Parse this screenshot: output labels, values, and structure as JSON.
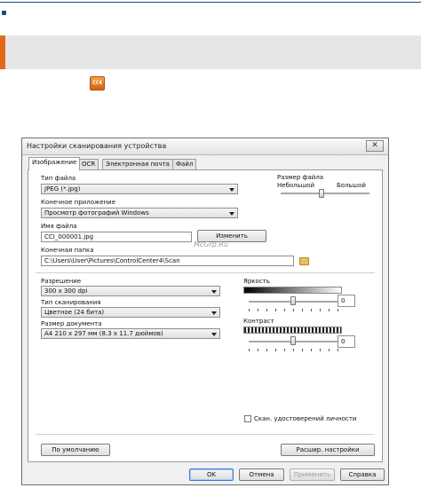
{
  "page": {
    "watermark": "McGrp.Ru"
  },
  "header_icon": {
    "label": "CC4"
  },
  "dialog": {
    "title": "Настройки сканирования устройства",
    "close_glyph": "✕",
    "tabs": [
      {
        "label": "Изображение",
        "active": true
      },
      {
        "label": "OCR",
        "active": false
      },
      {
        "label": "Электронная почта",
        "active": false
      },
      {
        "label": "Файл",
        "active": false
      }
    ],
    "file_type": {
      "label": "Тип файла",
      "value": "JPEG (*.jpg)"
    },
    "file_size": {
      "label": "Размер файла",
      "min_label": "Небольшой",
      "max_label": "Большой"
    },
    "target_app": {
      "label": "Конечное приложение",
      "value": "Просмотр фотографий Windows"
    },
    "file_name": {
      "label": "Имя файла",
      "value": "CCI_000001.jpg",
      "change_button": "Изменить"
    },
    "destination_folder": {
      "label": "Конечная папка",
      "value": "C:\\Users\\User\\Pictures\\ControlCenter4\\Scan"
    },
    "resolution": {
      "label": "Разрешение",
      "value": "300 x 300  dpi"
    },
    "scan_type": {
      "label": "Тип сканирования",
      "value": "Цветное (24 бита)"
    },
    "document_size": {
      "label": "Размер документа",
      "value": "A4 210 x 297 мм (8.3 x 11.7 дюймов)"
    },
    "brightness": {
      "label": "Яркость",
      "value": "0",
      "level": 0.5
    },
    "contrast": {
      "label": "Контраст",
      "value": "0",
      "level": 0.5
    },
    "id_card_scan": {
      "label": "Скан. удостоверений личности",
      "checked": false
    },
    "default_button": "По умолчанию",
    "advanced_button": "Расшир. настройки",
    "ok_button": "OK",
    "cancel_button": "Отмена",
    "apply_button": "Применить",
    "help_button": "Справка"
  },
  "colors": {
    "accent": "#e06a1a",
    "brand_blue": "#1a4a8a",
    "banner": "#e6e6e6"
  }
}
